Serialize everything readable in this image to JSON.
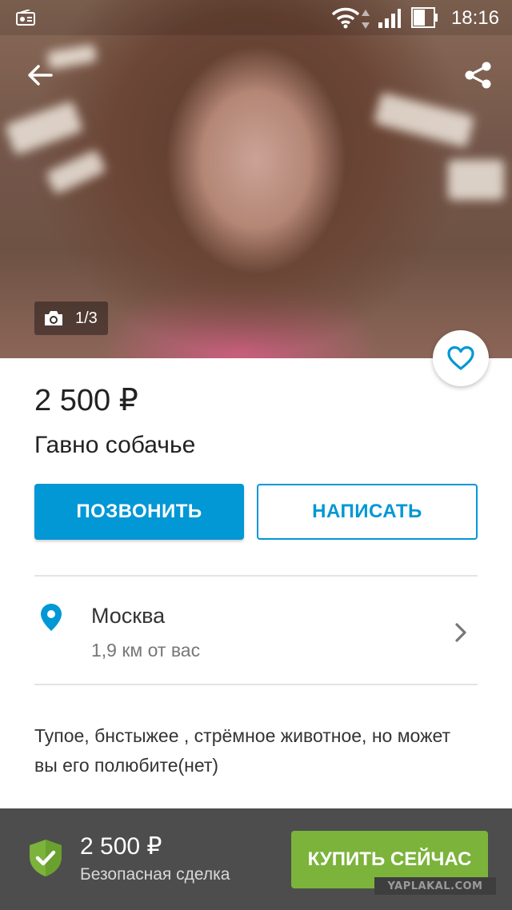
{
  "status_bar": {
    "time": "18:16"
  },
  "gallery": {
    "counter": "1/3"
  },
  "listing": {
    "price": "2 500 ₽",
    "title": "Гавно собачье",
    "call_label": "ПОЗВОНИТЬ",
    "write_label": "НАПИСАТЬ",
    "location": {
      "city": "Москва",
      "distance": "1,9 км от вас"
    },
    "description": "Тупое, бнстыжее , стрёмное животное, но может вы его полюбите(нет)"
  },
  "purchase_bar": {
    "price": "2 500 ₽",
    "safe_deal": "Безопасная сделка",
    "buy_label": "КУПИТЬ СЕЙЧАС"
  },
  "watermark": "YAPLAKAL.COM",
  "colors": {
    "accent": "#0297d5",
    "buy": "#7bb33b",
    "bottom_bar": "#4d4d4d",
    "shield": "#7bb33b"
  },
  "icons": [
    "back-arrow-icon",
    "share-icon",
    "camera-icon",
    "heart-icon",
    "location-pin-icon",
    "chevron-right-icon",
    "shield-check-icon",
    "wifi-icon",
    "signal-icon",
    "battery-icon",
    "radio-icon"
  ]
}
